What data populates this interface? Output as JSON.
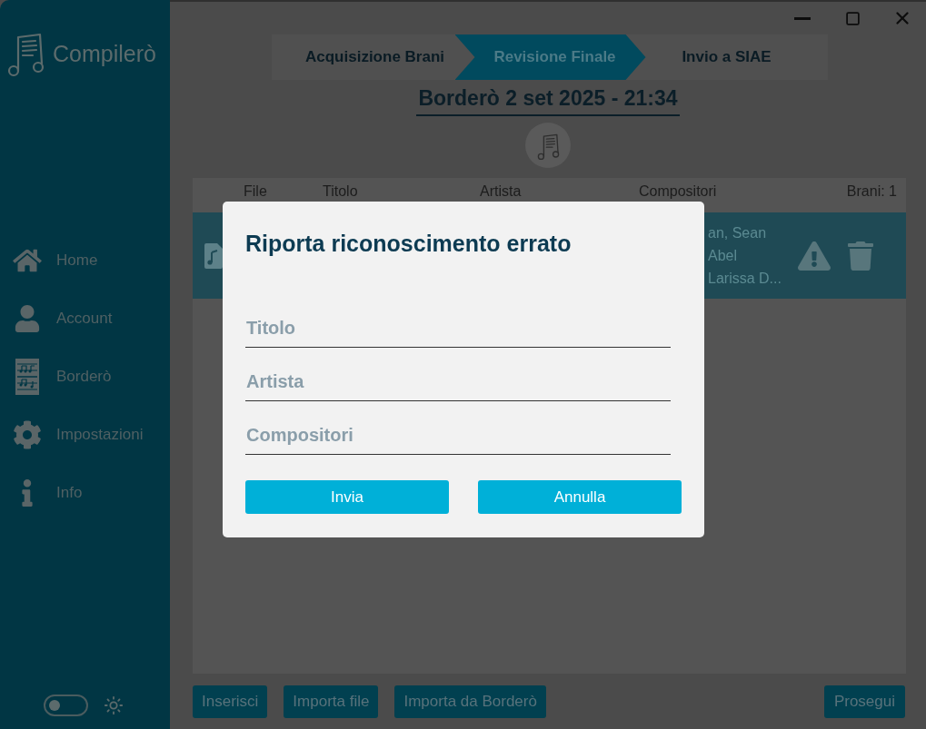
{
  "sidebar": {
    "app_name": "Compilerò",
    "nav_items": [
      {
        "label": "Home"
      },
      {
        "label": "Account"
      },
      {
        "label": "Borderò"
      },
      {
        "label": "Impostazioni"
      },
      {
        "label": "Info"
      }
    ],
    "theme_toggle": {
      "on": false
    }
  },
  "stepper": {
    "steps": [
      {
        "label": "Acquisizione Brani",
        "selected": false
      },
      {
        "label": "Revisione Finale",
        "selected": true
      },
      {
        "label": "Invio a SIAE",
        "selected": false
      }
    ]
  },
  "bordero_title": "Borderò 2 set 2025 - 21:34",
  "table": {
    "columns": [
      "File",
      "Titolo",
      "Artista",
      "Compositori"
    ],
    "track_count": "Brani: 1",
    "rows": [
      {
        "compositori_lines": [
          "an, Sean",
          "Abel",
          "Larissa D..."
        ]
      }
    ]
  },
  "actions": {
    "buttons": [
      "Inserisci",
      "Importa file",
      "Importa da Borderò"
    ],
    "proceed": "Prosegui"
  },
  "dialog": {
    "title": "Riporta riconoscimento errato",
    "fields": [
      {
        "placeholder": "Titolo"
      },
      {
        "placeholder": "Artista"
      },
      {
        "placeholder": "Compositori"
      }
    ],
    "buttons": [
      "Invia",
      "Annulla"
    ]
  }
}
